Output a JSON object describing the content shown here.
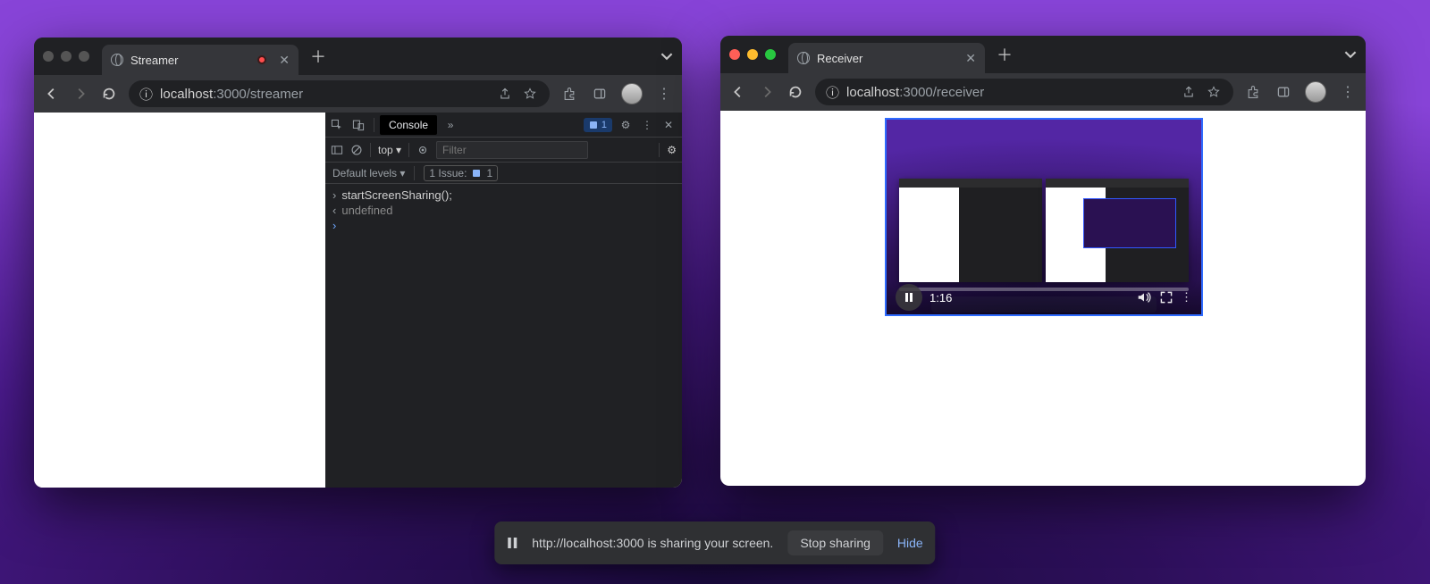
{
  "left": {
    "tab_title": "Streamer",
    "url_host": "localhost",
    "url_rest": ":3000/streamer",
    "devtools": {
      "console_tab": "Console",
      "issues_count": "1",
      "context": "top",
      "filter_placeholder": "Filter",
      "levels": "Default levels",
      "issue_label": "1 Issue:",
      "issue_count2": "1",
      "line1": "startScreenSharing();",
      "line2": "undefined"
    }
  },
  "right": {
    "tab_title": "Receiver",
    "url_host": "localhost",
    "url_rest": ":3000/receiver",
    "video_time": "1:16"
  },
  "sharebar": {
    "text": "http://localhost:3000 is sharing your screen.",
    "stop": "Stop sharing",
    "hide": "Hide"
  }
}
